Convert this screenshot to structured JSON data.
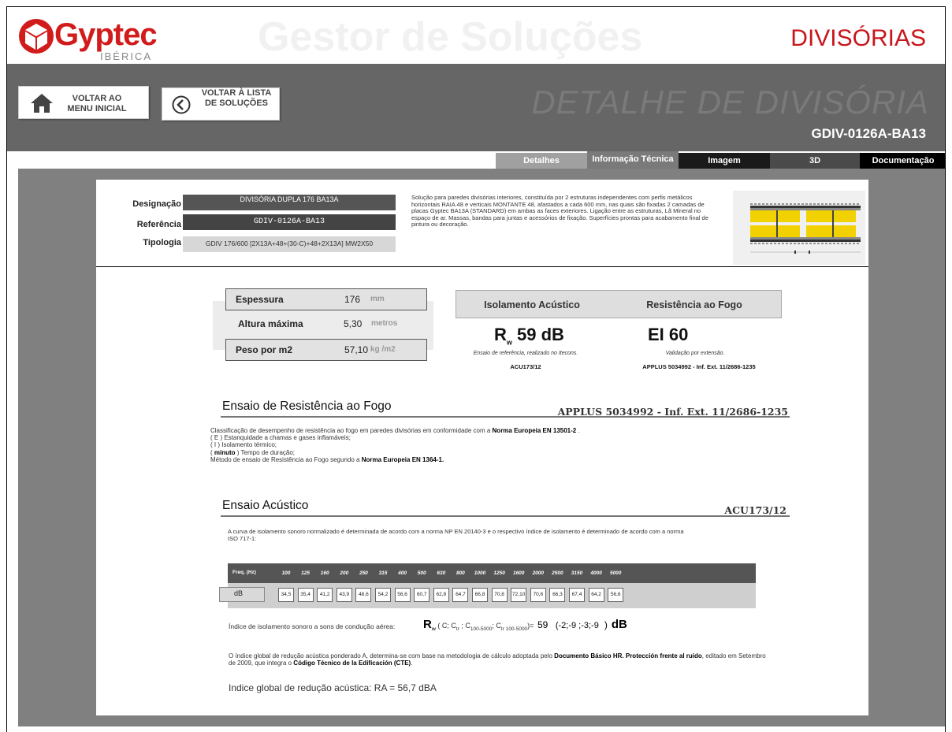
{
  "header": {
    "brand": "Gyptec",
    "brand_sub": "IBÉRICA",
    "app_title": "Gestor de Soluções",
    "section_title": "DIVISÓRIAS"
  },
  "nav": {
    "home_label_1": "VOLTAR AO",
    "home_label_2": "MENU INICIAL",
    "list_label_1": "VOLTAR À LISTA",
    "list_label_2": "DE SOLUÇÕES",
    "detail_title": "DETALHE DE DIVISÓRIA",
    "detail_code": "GDIV-0126A-BA13"
  },
  "tabs": {
    "details": "Detalhes",
    "info": "Informação Técnica",
    "image": "Imagem",
    "three_d": "3D",
    "docs": "Documentação"
  },
  "info": {
    "designation_label": "Designação",
    "designation_value": "DIVISÓRIA DUPLA 176 BA13A",
    "reference_label": "Referência",
    "reference_value": "GDIV-0126A-BA13",
    "typology_label": "Tipologia",
    "typology_value": "GDIV 176/600 [2X13A+48+(30-C)+48+2X13A] MW2X50",
    "description": "Solução para paredes divisórias interiores, constituída por 2 estruturas independentes com perfis metálicos horizontais RAIA 48 e verticais MONTANTE 48, afastados a cada 600 mm, nas quais são fixadas 2 camadas de placas Gyptec BA13A (STANDARD) em ambas as faces exteriores. Ligação entre as estruturas, Lã Mineral no espaço de ar.  Massas, bandas para juntas e acessórios de fixação. Superfícies prontas para acabamento final de pintura ou decoração."
  },
  "specs": {
    "thickness_label": "Espessura",
    "thickness_value": "176",
    "thickness_unit": "mm",
    "height_label": "Altura máxima",
    "height_value": "5,30",
    "height_unit": "metros",
    "weight_label": "Peso por m2",
    "weight_value": "57,10",
    "weight_unit": "kg /m2"
  },
  "performance": {
    "acoustic_header": "Isolamento Acústico",
    "fire_header": "Resistência ao Fogo",
    "rw_symbol": "R",
    "rw_sub": "w",
    "rw_value": "59 dB",
    "ei_value": "EI 60",
    "acoustic_note": "Ensaio de referência, realizado no Itecons.",
    "acoustic_ref": "ACU173/12",
    "fire_note": "Validação por extensão.",
    "fire_ref": "APPLUS 5034992 - Inf. Ext. 11/2686-1235"
  },
  "fire_section": {
    "title": "Ensaio de Resistência ao Fogo",
    "ref": "APPLUS 5034992 - Inf. Ext. 11/2686-1235",
    "line1_a": "Classificação de desempenho de resistência ao fogo em paredes divisórias em conformidade com a ",
    "line1_b": "Norma Europeia EN 13501-2",
    "line1_c": " .",
    "line2": "( E ) Estanquidade a chamas e gases inflamáveis;",
    "line3": "( I ) Isolamento térmico;",
    "line4_a": "( ",
    "line4_b": "minuto",
    "line4_c": " ) Tempo de duração;",
    "line5_a": "Método de ensaio de Resistência ao Fogo segundo a ",
    "line5_b": "Norma Europeia EN 1364-1."
  },
  "acoustic_section": {
    "title": "Ensaio Acústico",
    "ref": "ACU173/12",
    "text": "A curva de isolamento sonoro normalizado é determinada de acordo com a norma NP EN 20140-3 e o respectivo índice de isolamento é determinado de acordo com a norma ISO 717-1:",
    "freq_label": "Freq. (Hz)",
    "db_label": "dB",
    "frequencies": [
      "100",
      "125",
      "160",
      "200",
      "250",
      "315",
      "400",
      "500",
      "630",
      "800",
      "1000",
      "1250",
      "1600",
      "2000",
      "2500",
      "3150",
      "4000",
      "5000"
    ],
    "values": [
      "34,5",
      "35,4",
      "41,2",
      "43,9",
      "48,6",
      "54,2",
      "56,6",
      "60,7",
      "62,8",
      "64,7",
      "66,8",
      "70,8",
      "72,10",
      "70,6",
      "66,3",
      "67,4",
      "64,2",
      "56,6"
    ],
    "index_label": "Índice de isolamento sonoro a sons de condução aérea:",
    "index_R": "R",
    "index_sub": "w",
    "index_terms": "( C; C",
    "index_terms_tr": "tr",
    "index_terms_2": " ; C",
    "index_terms_2s": "100-5000",
    "index_terms_3": "; C",
    "index_terms_3s": "tr 100-5000",
    "index_terms_4": ")=",
    "index_value": "59",
    "index_corr": "(-2;-9 ;-3;-9",
    "index_close": ")",
    "index_unit": "dB",
    "global_text_a": "O índice global de redução acústica ponderado A, determina-se com base na metodologia de cálculo adoptada pelo ",
    "global_text_b": "Documento Básico HR. Protección frente al ruido",
    "global_text_c": ", editado em Setembro de 2009, que integra o ",
    "global_text_d": "Código Técnico de la Edificación (CTE)",
    "global_text_e": ".",
    "global_line": "Indice global de redução acústica:  RA = 56,7 dBA"
  },
  "colors": {
    "brand_red": "#d21b1b",
    "nav_grey": "#666666",
    "content_grey": "#808080"
  }
}
